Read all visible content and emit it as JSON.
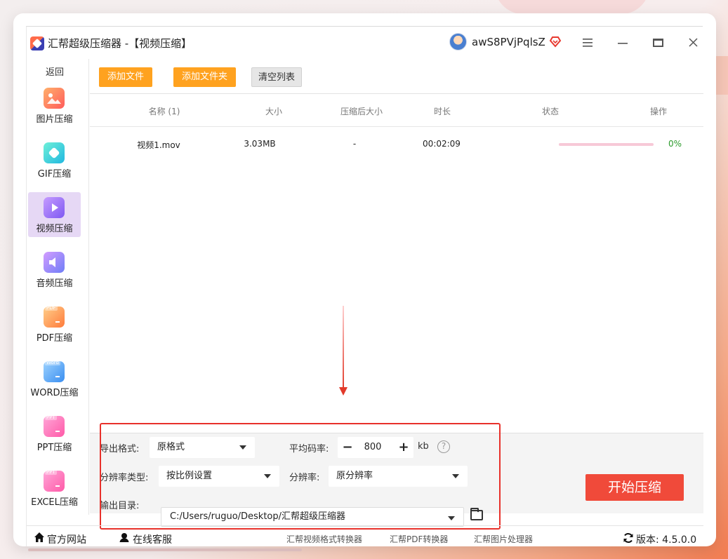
{
  "app": {
    "title": "汇帮超级压缩器  -【视频压缩】",
    "username": "awS8PVjPqlsZ"
  },
  "icons": {
    "logo": "app-logo-icon",
    "vip": "diamond-heart-icon",
    "menu": "hamburger-menu-icon",
    "minimize": "minimize-icon",
    "maximize": "maximize-icon",
    "close": "close-icon"
  },
  "sidebar": {
    "back": "返回",
    "items": [
      {
        "label": "图片压缩",
        "icon": "image-icon"
      },
      {
        "label": "GIF压缩",
        "icon": "gif-icon"
      },
      {
        "label": "视频压缩",
        "icon": "video-play-icon",
        "active": true
      },
      {
        "label": "音频压缩",
        "icon": "audio-speaker-icon"
      },
      {
        "label": "PDF压缩",
        "icon": "pdf-icon",
        "tag": "PDF"
      },
      {
        "label": "WORD压缩",
        "icon": "word-icon",
        "tag": "Word"
      },
      {
        "label": "PPT压缩",
        "icon": "ppt-icon",
        "tag": "PPT"
      },
      {
        "label": "EXCEL压缩",
        "icon": "excel-icon",
        "tag": "PPT"
      }
    ]
  },
  "toolbar": {
    "add_file": "添加文件",
    "add_folder": "添加文件夹",
    "clear_list": "清空列表"
  },
  "table": {
    "headers": {
      "name": "名称 (1)",
      "size": "大小",
      "compressed_size": "压缩后大小",
      "duration": "时长",
      "status": "状态",
      "action": "操作"
    },
    "rows": [
      {
        "name": "视频1.mov",
        "size": "3.03MB",
        "compressed_size": "-",
        "duration": "00:02:09",
        "progress": 0,
        "progress_text": "0%"
      }
    ]
  },
  "settings": {
    "export_format_label": "导出格式:",
    "export_format_value": "原格式",
    "bitrate_label": "平均码率:",
    "bitrate_value": "800",
    "bitrate_unit": "kb",
    "resolution_type_label": "分辨率类型:",
    "resolution_type_value": "按比例设置",
    "resolution_label": "分辨率:",
    "resolution_value": "原分辨率",
    "output_dir_label": "输出目录:",
    "output_dir_value": "C:/Users/ruguo/Desktop/汇帮超级压缩器",
    "start_button": "开始压缩"
  },
  "footer": {
    "website": "官方网站",
    "service": "在线客服",
    "links": [
      "汇帮视频格式转换器",
      "汇帮PDF转换器",
      "汇帮图片处理器"
    ],
    "version": "版本:  4.5.0.0"
  },
  "colors": {
    "accent_orange": "#ffa21f",
    "start_red": "#f04a3a",
    "highlight_red": "#e8312b",
    "progress_pink": "#f7c9d7",
    "success_green": "#2b9a2b",
    "active_sidebar": "#e6d8f5"
  }
}
